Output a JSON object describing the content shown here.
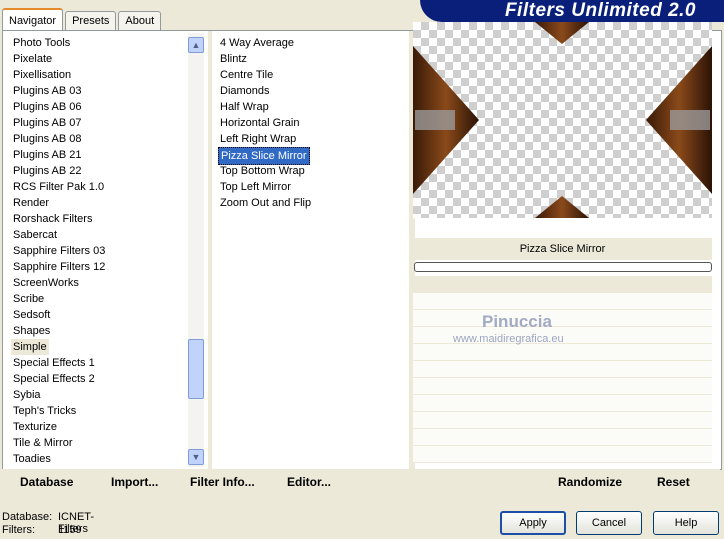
{
  "brand": "Filters Unlimited 2.0",
  "tabs": [
    "Navigator",
    "Presets",
    "About"
  ],
  "categories": [
    "Photo Tools",
    "Pixelate",
    "Pixellisation",
    "Plugins AB 03",
    "Plugins AB 06",
    "Plugins AB 07",
    "Plugins AB 08",
    "Plugins AB 21",
    "Plugins AB 22",
    "RCS Filter Pak 1.0",
    "Render",
    "Rorshack Filters",
    "Sabercat",
    "Sapphire Filters 03",
    "Sapphire Filters 12",
    "ScreenWorks",
    "Scribe",
    "Sedsoft",
    "Shapes",
    "Simple",
    "Special Effects 1",
    "Special Effects 2",
    "Sybia",
    "Teph's Tricks",
    "Texturize",
    "Tile & Mirror",
    "Toadies"
  ],
  "selected_category": "Simple",
  "filters": [
    "4 Way Average",
    "Blintz",
    "Centre Tile",
    "Diamonds",
    "Half Wrap",
    "Horizontal Grain",
    "Left Right Wrap",
    "Pizza Slice Mirror",
    "Top Bottom Wrap",
    "Top Left Mirror",
    "Zoom Out and Flip"
  ],
  "selected_filter": "Pizza Slice Mirror",
  "preview_filter_name": "Pizza Slice Mirror",
  "watermark": {
    "line1": "Pinuccia",
    "line2": "www.maidiregrafica.eu"
  },
  "bottom_links": {
    "database": "Database",
    "import": "Import...",
    "filter_info": "Filter Info...",
    "editor": "Editor...",
    "randomize": "Randomize",
    "reset": "Reset"
  },
  "status": {
    "database_label": "Database:",
    "database_value": "ICNET-Filters",
    "filters_label": "Filters:",
    "filters_value": "1159"
  },
  "buttons": {
    "apply": "Apply",
    "cancel": "Cancel",
    "help": "Help"
  },
  "colors": {
    "brand_bg": "#0a1f7a",
    "selection": "#316ac5"
  }
}
